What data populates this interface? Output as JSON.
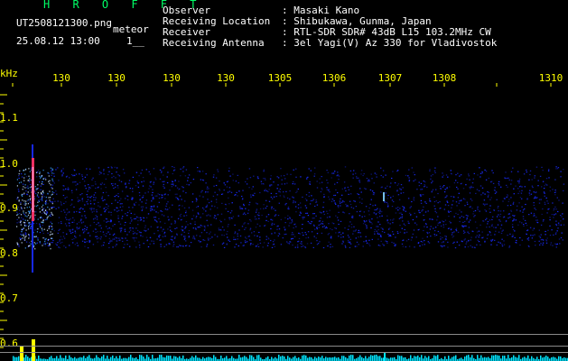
{
  "app": {
    "title": "H R O F F T",
    "filename": "UT2508121300.png",
    "mode": "meteor",
    "datetime": "25.08.12 13:00",
    "count": "1__"
  },
  "info": {
    "labels": [
      "Observer",
      "Receiving Location",
      "Receiver",
      "Receiving Antenna"
    ],
    "values": [
      ": Masaki Kano",
      ": Shibukawa, Gunma, Japan",
      ": RTL-SDR SDR# 43dB L15 103.2MHz CW",
      ": 3el Yagi(V) Az 330 for Vladivostok"
    ]
  },
  "axes": {
    "y_unit": "kHz",
    "y_ticks": [
      "1.1",
      "1.0",
      "0.9",
      "0.8",
      "0.7",
      "0.6"
    ],
    "x_ticks": [
      "130",
      "130",
      "130",
      "130",
      "1305",
      "1306",
      "1307",
      "1308",
      "1310"
    ]
  },
  "colors": {
    "background": "#000000",
    "text_yellow": "#ffff00",
    "title_green": "#00ff66",
    "header_white": "#ffffff",
    "signal_blue": "#1a2cff",
    "meteor_red": "#ff3060",
    "baseline_cyan": "#00e5ff"
  }
}
